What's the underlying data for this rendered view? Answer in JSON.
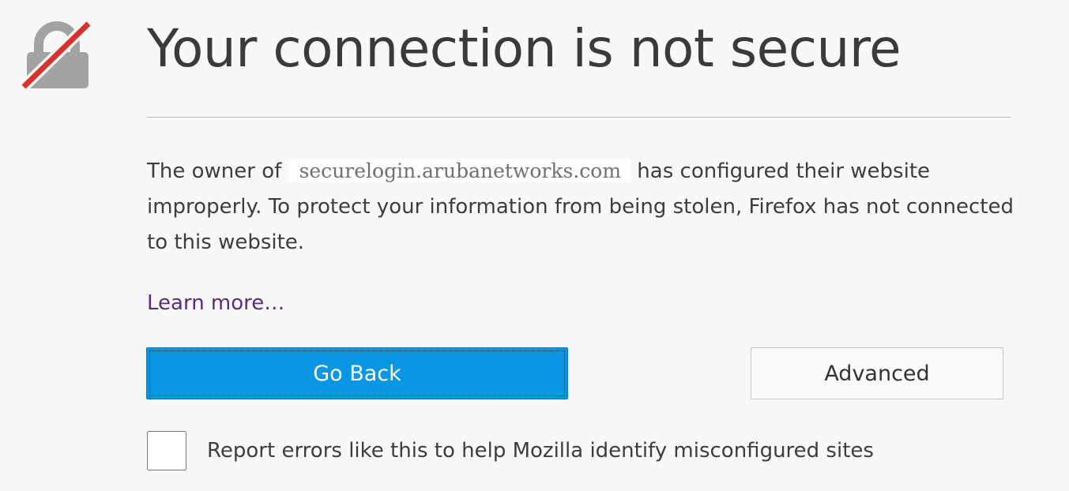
{
  "page": {
    "title": "Your connection is not secure",
    "description_before": "The owner of",
    "hostname": "securelogin.arubanetworks.com",
    "description_after": "has configured their website improperly. To protect your information from being stolen, Firefox has not connected to this website.",
    "learn_more": "Learn more…"
  },
  "buttons": {
    "go_back": "Go Back",
    "advanced": "Advanced"
  },
  "report": {
    "label": "Report errors like this to help Mozilla identify misconfigured sites",
    "checked": false
  },
  "icons": {
    "warning": "broken-lock-icon"
  },
  "colors": {
    "background": "#f8f8f8",
    "primary_button": "#0996e3",
    "lock_body": "#a3a3a3",
    "slash": "#d7322b",
    "link": "#5a2d7c"
  }
}
